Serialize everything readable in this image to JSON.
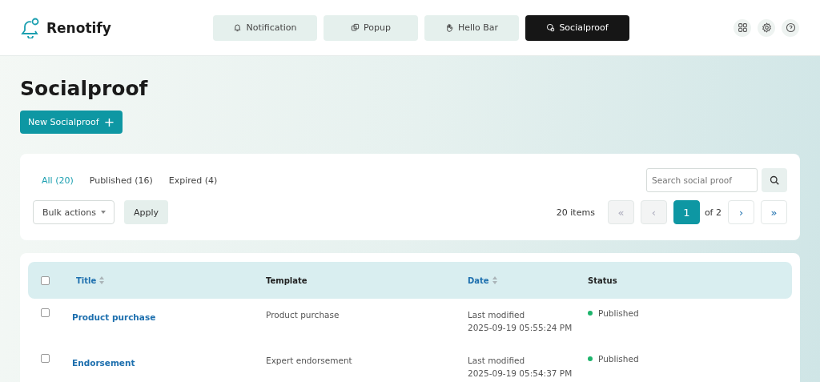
{
  "brand": {
    "name": "Renotify"
  },
  "nav_tabs": [
    {
      "label": "Notification",
      "kind": "bell",
      "selected": false
    },
    {
      "label": "Popup",
      "kind": "popup",
      "selected": false
    },
    {
      "label": "Hello Bar",
      "kind": "wave",
      "selected": false
    },
    {
      "label": "Socialproof",
      "kind": "social",
      "selected": true
    }
  ],
  "header_actions": [
    {
      "kind": "grid"
    },
    {
      "kind": "settings"
    },
    {
      "kind": "help"
    }
  ],
  "page_title": "Socialproof",
  "new_button": {
    "label": "New Socialproof",
    "icon": "+"
  },
  "filters": [
    {
      "label": "All (20)",
      "selected": true
    },
    {
      "label": "Published (16)",
      "selected": false
    },
    {
      "label": "Expired (4)",
      "selected": false
    }
  ],
  "search": {
    "placeholder": "Search social proof"
  },
  "bulk_actions": {
    "value": "Bulk actions"
  },
  "apply_button": "Apply",
  "pagination": {
    "count": "20 items",
    "of": "of 2",
    "buttons": [
      {
        "label": "«",
        "selected": false,
        "disabled": true
      },
      {
        "label": "‹",
        "selected": false,
        "disabled": true
      },
      {
        "label": "1",
        "selected": true,
        "disabled": false
      },
      {
        "label": "›",
        "selected": false,
        "disabled": false
      },
      {
        "label": "»",
        "selected": false,
        "disabled": false
      }
    ]
  },
  "table": {
    "select_all_checked": false,
    "columns": [
      {
        "label": "Title",
        "sortable": true
      },
      {
        "label": "Template",
        "sortable": false
      },
      {
        "label": "Date",
        "sortable": true
      },
      {
        "label": "Status",
        "sortable": false
      }
    ],
    "rows": [
      {
        "checked": false,
        "title": "Product purchase",
        "template": "Product purchase",
        "date_label": "Last modified",
        "date": "2025-09-19 05:55:24 PM",
        "status": "Published",
        "color": "#1db46c"
      },
      {
        "checked": false,
        "title": "Endorsement",
        "template": "Expert endorsement",
        "date_label": "Last modified",
        "date": "2025-09-19 05:54:37 PM",
        "status": "Published",
        "color": "#1db46c"
      }
    ]
  }
}
